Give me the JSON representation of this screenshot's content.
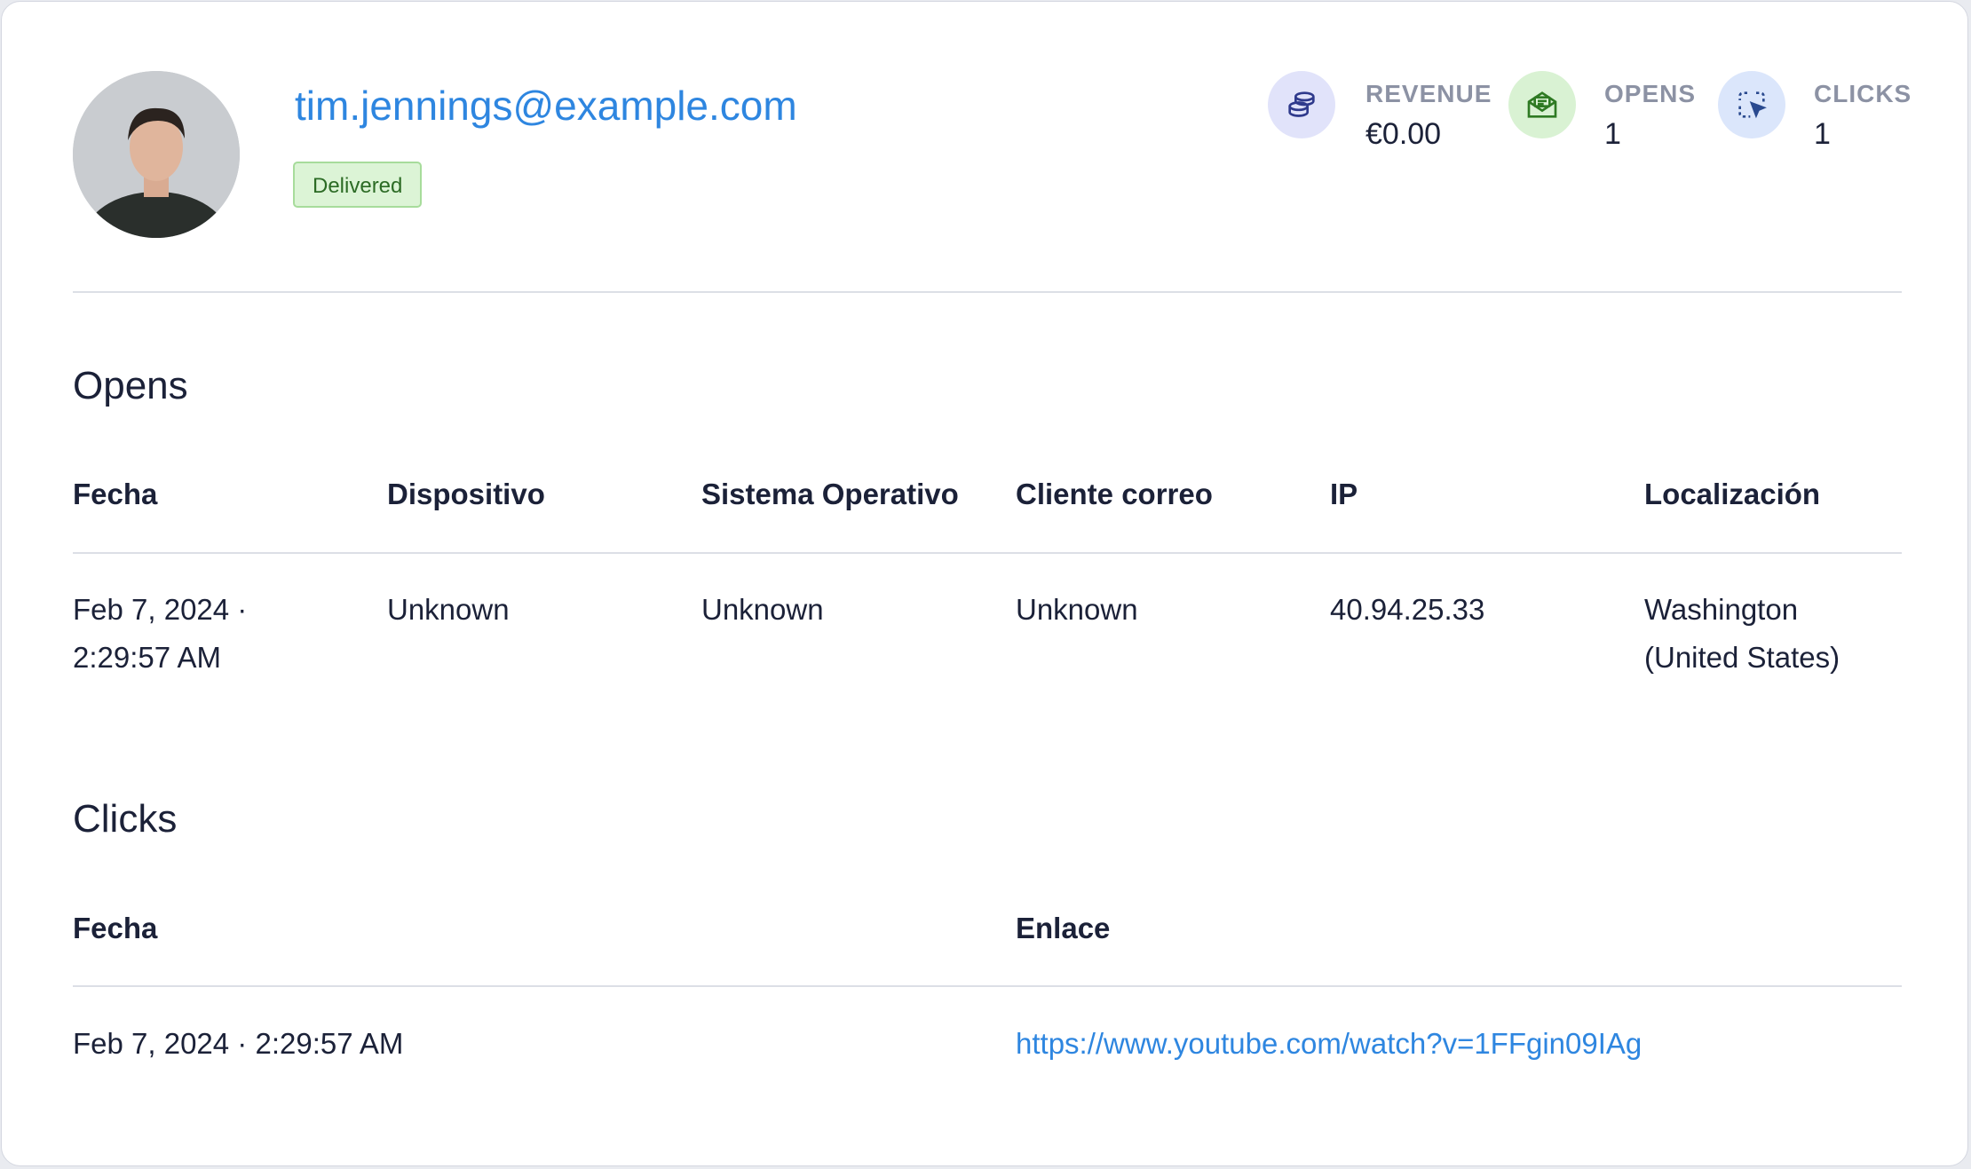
{
  "recipient": {
    "email": "tim.jennings@example.com",
    "status": "Delivered"
  },
  "stats": {
    "revenue": {
      "label": "REVENUE",
      "value": "€0.00",
      "icon": "coins-icon",
      "color": "#e1e3fa"
    },
    "opens": {
      "label": "OPENS",
      "value": "1",
      "icon": "open-envelope-icon",
      "color": "#d9f2d3"
    },
    "clicks": {
      "label": "CLICKS",
      "value": "1",
      "icon": "cursor-click-icon",
      "color": "#dbe6fb"
    }
  },
  "opens": {
    "title": "Opens",
    "columns": [
      "Fecha",
      "Dispositivo",
      "Sistema Operativo",
      "Cliente correo",
      "IP",
      "Localización"
    ],
    "rows": [
      {
        "fecha_line1": "Feb 7, 2024 ·",
        "fecha_line2": "2:29:57 AM",
        "dispositivo": "Unknown",
        "sistema": "Unknown",
        "cliente": "Unknown",
        "ip": "40.94.25.33",
        "loc_line1": "Washington",
        "loc_line2": "(United States)"
      }
    ]
  },
  "clicks": {
    "title": "Clicks",
    "columns": [
      "Fecha",
      "Enlace"
    ],
    "rows": [
      {
        "fecha": "Feb 7, 2024 · 2:29:57 AM",
        "enlace": "https://www.youtube.com/watch?v=1FFgin09IAg"
      }
    ]
  }
}
